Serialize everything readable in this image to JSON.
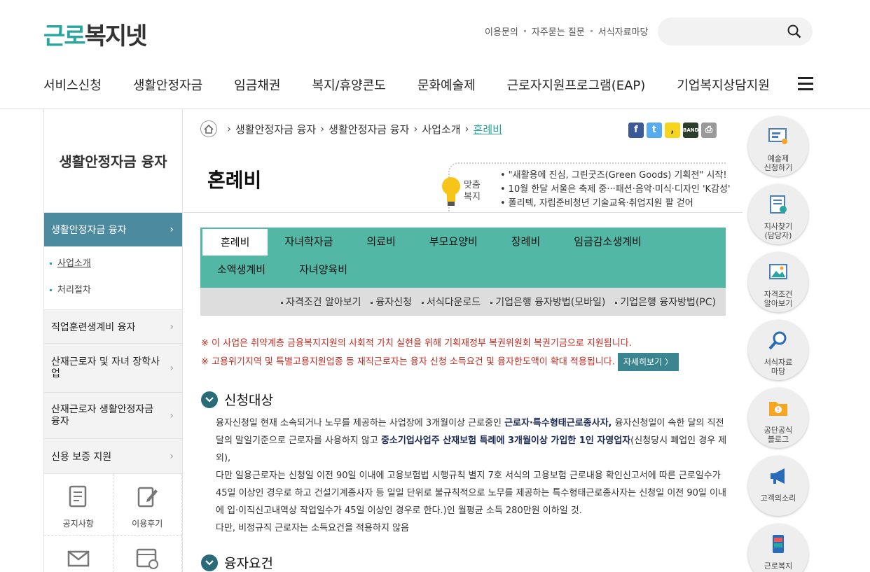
{
  "site": {
    "logo_part1": "근로",
    "logo_part2": "복지넷"
  },
  "util": [
    "이용문의",
    "자주묻는 질문",
    "서식자료마당"
  ],
  "gnb": [
    "서비스신청",
    "생활안정자금",
    "임금채권",
    "복지/휴양콘도",
    "문화예술제",
    "근로자지원프로그램(EAP)",
    "기업복지상담지원"
  ],
  "lnb": {
    "title": "생활안정자금 융자",
    "active": "생활안정자금 융자",
    "sub": [
      "사업소개",
      "처리절차"
    ],
    "items": [
      "직업훈련생계비 융자",
      "산재근로자 및 자녀 장학사업",
      "산재근로자 생활안정자금 융자",
      "신용 보증 지원"
    ],
    "quick": [
      "공지사항",
      "이용후기",
      "",
      ""
    ]
  },
  "breadcrumb": [
    "생활안정자금 융자",
    "생활안정자금 융자",
    "사업소개",
    "혼례비"
  ],
  "page_title": "혼례비",
  "custom_label": [
    "맞춤",
    "복지"
  ],
  "news": [
    "\"새활용에 진심, 그린굿즈(Green Goods) 기획전\" 시작!",
    "10월 한달 서울은 축제 중···패션·음악·미식·디자인 'K감성'",
    "폴리텍, 자립준비청년 기술교육·취업지원 팔 걷어"
  ],
  "tabs_row1": [
    "혼례비",
    "자녀학자금",
    "의료비",
    "부모요양비",
    "장례비",
    "임금감소생계비"
  ],
  "tabs_row2": [
    "소액생계비",
    "자녀양육비"
  ],
  "subtabs": [
    "자격조건 알아보기",
    "융자신청",
    "서식다운로드",
    "기업은행 융자방법(모바일)",
    "기업은행 융자방법(PC)"
  ],
  "notice": [
    "※ 이 사업은 취약계층 금융복지지원의 사회적 가치 실현을 위해 기획재정부 복권위원회 복권기금으로 지원됩니다.",
    "※ 고용위기지역 및 특별고용지원업종 등 재직근로자는 융자 신청 소득요건 및 융자한도액이 확대 적용됩니다."
  ],
  "notice_btn": "자세히보기 〉",
  "sec1": "신청대상",
  "sec2": "융자요건",
  "body": {
    "p1a": "융자신청일 현재 소속되거나 노무를 제공하는 사업장에 3개월이상 근로중인 ",
    "p1b": "근로자·특수형태근로종사자,",
    "p1c": " 융자신청일이 속한 달의 직전 달의 말일기준으로 근로자를 사용하지 않고 ",
    "p1d": "중소기업사업주 산재보험 특례에 3개월이상 가입한 1인 자영업자",
    "p1e": "(신청당시 폐업인 경우 제외),",
    "p2": "다만 일용근로자는 신청일 이전 90일 이내에 고용보험법 시행규칙 별지 7호 서식의 고용보험 근로내용 확인신고서에 따른 근로일수가 45일 이상인 경우로 하고 건설기계종사자 등 일일 단위로 불규칙적으로 노무를 제공하는 특수형태근로종사자는 신청일 이전 90일 이내에 입·이직신고내역상 작업일수가 45일 이상인 경우로 한다.)인 월평균 소득 280만원 이하일 것.",
    "p3": "다만, 비정규직 근로자는 소득요건을 적용하지 않음"
  },
  "right_quick": [
    "예술제\n신청하기",
    "지사찾기\n(담당자)",
    "자격조건\n알아보기",
    "서식자료\n마당",
    "공단공식\n블로그",
    "고객의소리",
    "근로복지"
  ]
}
